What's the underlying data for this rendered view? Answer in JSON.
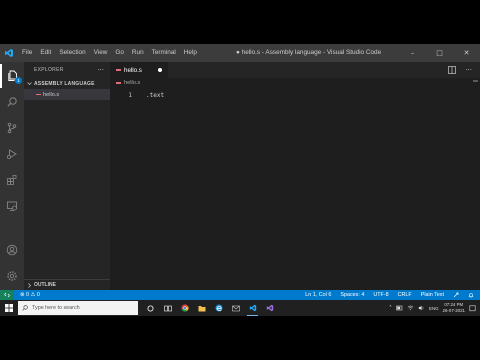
{
  "window": {
    "title": "● hello.s - Assembly language - Visual Studio Code",
    "controls": {
      "minimize": "–",
      "maximize": "□",
      "close": "✕"
    }
  },
  "menu": [
    "File",
    "Edit",
    "Selection",
    "View",
    "Go",
    "Run",
    "Terminal",
    "Help"
  ],
  "activity_bar": {
    "explorer_badge": "1",
    "icons": [
      "files-icon",
      "search-icon",
      "source-control-icon",
      "run-debug-icon",
      "extensions-icon",
      "remote-explorer-icon",
      "account-icon",
      "settings-gear-icon"
    ]
  },
  "sidebar": {
    "title": "EXPLORER",
    "more": "···",
    "folder": "ASSEMBLY LANGUAGE",
    "files": [
      {
        "name": "hello.s"
      }
    ],
    "outline": "OUTLINE"
  },
  "editor": {
    "tab": {
      "label": "hello.s",
      "dirty": true
    },
    "breadcrumb": "hello.s",
    "lines": [
      {
        "number": "1",
        "text": ".text"
      }
    ]
  },
  "status_bar": {
    "problems": "⊗ 0  ⚠ 0",
    "cursor": "Ln 1, Col 6",
    "spaces": "Spaces: 4",
    "encoding": "UTF-8",
    "eol": "CRLF",
    "language": "Plain Text",
    "colors": {
      "background": "#007acc",
      "remote": "#16825d"
    }
  },
  "taskbar": {
    "search_placeholder": "Type here to search",
    "tray_lang": "ENG",
    "time": "07:24 PM",
    "date": "26-07-2021"
  }
}
